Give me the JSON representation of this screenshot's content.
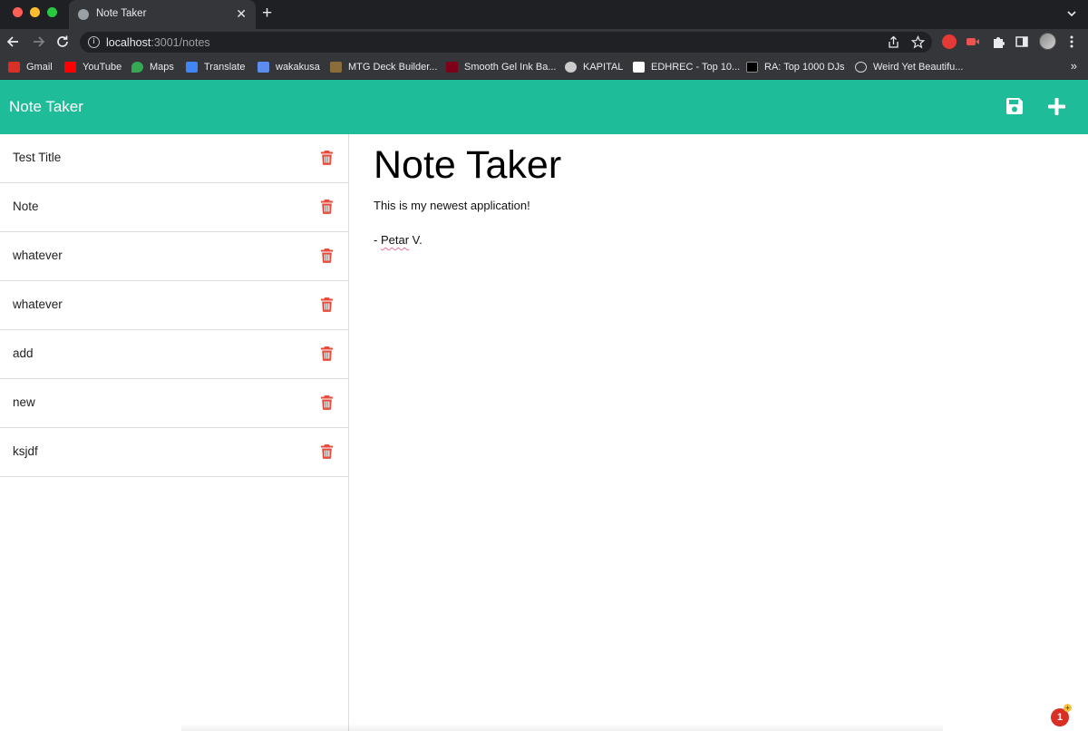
{
  "browser": {
    "tab_title": "Note Taker",
    "tab_close": "✕",
    "new_tab": "+",
    "url_host": "localhost",
    "url_path": ":3001/notes",
    "bookmarks_more": "»",
    "bookmarks": [
      {
        "label": "Gmail",
        "icon": "gmail-icon",
        "color": "#d93025"
      },
      {
        "label": "YouTube",
        "icon": "youtube-icon",
        "color": "#ff0000"
      },
      {
        "label": "Maps",
        "icon": "maps-icon",
        "color": "#34a853"
      },
      {
        "label": "Translate",
        "icon": "translate-icon",
        "color": "#4285f4"
      },
      {
        "label": "wakakusa",
        "icon": "grid-icon",
        "color": "#5b8def"
      },
      {
        "label": "MTG Deck Builder...",
        "icon": "mtg-icon",
        "color": "#8a6d3b"
      },
      {
        "label": "Smooth Gel Ink Ba...",
        "icon": "muji-icon",
        "color": "#7f0019"
      },
      {
        "label": "KAPITAL",
        "icon": "kapital-icon",
        "color": "#cccccc"
      },
      {
        "label": "EDHREC - Top 10...",
        "icon": "edhrec-icon",
        "color": "#ffffff"
      },
      {
        "label": "RA: Top 1000 DJs",
        "icon": "ra-icon",
        "color": "#000000"
      },
      {
        "label": "Weird Yet Beautifu...",
        "icon": "loop-icon",
        "color": "#cfd8dc"
      }
    ]
  },
  "app": {
    "title": "Note Taker",
    "accent_color": "#1fbc99",
    "delete_color": "#e74c3c"
  },
  "notes": [
    {
      "title": "Test Title"
    },
    {
      "title": "Note"
    },
    {
      "title": "whatever"
    },
    {
      "title": "whatever"
    },
    {
      "title": "add"
    },
    {
      "title": "new"
    },
    {
      "title": "ksjdf"
    }
  ],
  "active_note": {
    "title": "Note Taker",
    "line1": "This is my newest application!",
    "line2_prefix": "- ",
    "line2_name": "Petar",
    "line2_suffix": " V."
  },
  "notification": {
    "count": "1",
    "plus": "+"
  }
}
